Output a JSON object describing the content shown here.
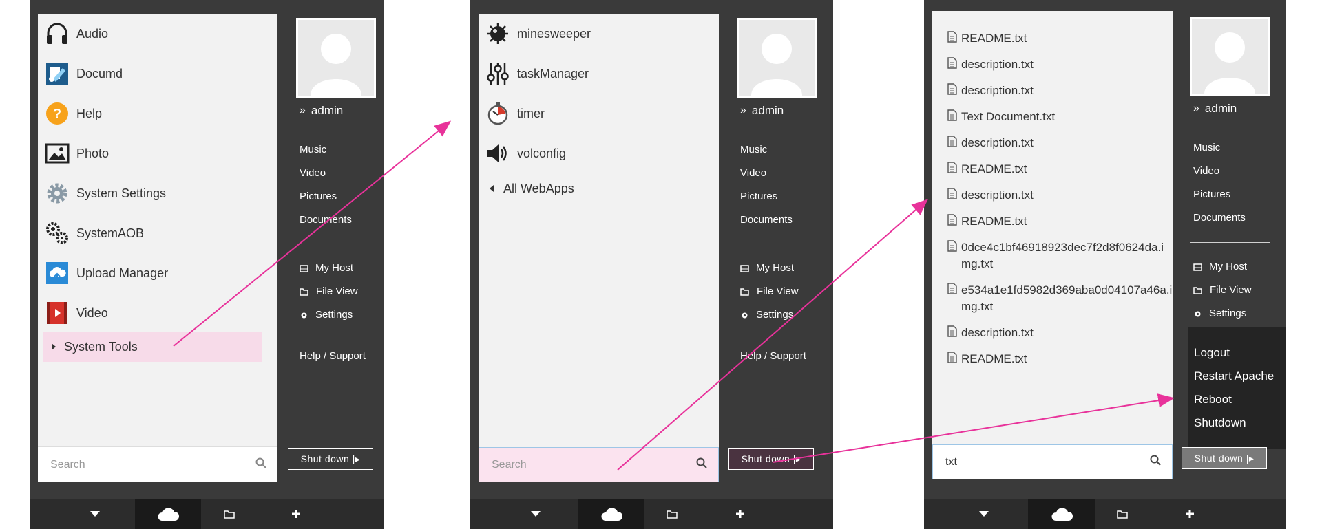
{
  "panels": [
    {
      "apps": [
        {
          "label": "Audio",
          "icon": "headphones-icon"
        },
        {
          "label": "Documd",
          "icon": "document-editor-icon"
        },
        {
          "label": "Help",
          "icon": "help-icon"
        },
        {
          "label": "Photo",
          "icon": "photo-icon"
        },
        {
          "label": "System Settings",
          "icon": "gear-icon"
        },
        {
          "label": "SystemAOB",
          "icon": "gears-icon"
        },
        {
          "label": "Upload Manager",
          "icon": "cloud-upload-icon"
        },
        {
          "label": "Video",
          "icon": "film-icon"
        }
      ],
      "folder": "System Tools",
      "search_placeholder": "Search",
      "user": "admin",
      "links": [
        "Music",
        "Video",
        "Pictures",
        "Documents"
      ],
      "tools": [
        "My Host",
        "File View",
        "Settings"
      ],
      "help": "Help / Support",
      "shutdown": "Shut down |▸"
    },
    {
      "apps": [
        {
          "label": "minesweeper",
          "icon": "mine-icon"
        },
        {
          "label": "taskManager",
          "icon": "sliders-icon"
        },
        {
          "label": "timer",
          "icon": "stopwatch-icon"
        },
        {
          "label": "volconfig",
          "icon": "speaker-icon"
        }
      ],
      "back": "All WebApps",
      "search_placeholder": "Search",
      "user": "admin",
      "links": [
        "Music",
        "Video",
        "Pictures",
        "Documents"
      ],
      "tools": [
        "My Host",
        "File View",
        "Settings"
      ],
      "help": "Help / Support",
      "shutdown": "Shut down |▸"
    },
    {
      "files": [
        "README.txt",
        "description.txt",
        "description.txt",
        "Text Document.txt",
        "description.txt",
        "README.txt",
        "description.txt",
        "README.txt",
        "0dce4c1bf46918923dec7f2d8f0624da.img.txt",
        "e534a1e1fd5982d369aba0d04107a46a.img.txt",
        "description.txt",
        "README.txt"
      ],
      "search_value": "txt",
      "user": "admin",
      "links": [
        "Music",
        "Video",
        "Pictures",
        "Documents"
      ],
      "tools": [
        "My Host",
        "File View",
        "Settings"
      ],
      "power": [
        "Logout",
        "Restart Apache",
        "Reboot",
        "Shutdown"
      ],
      "shutdown": "Shut down |▸"
    }
  ],
  "colors": {
    "accent": "#e8329a",
    "panel": "#3a3a3a",
    "highlight": "#f7dbe9"
  }
}
